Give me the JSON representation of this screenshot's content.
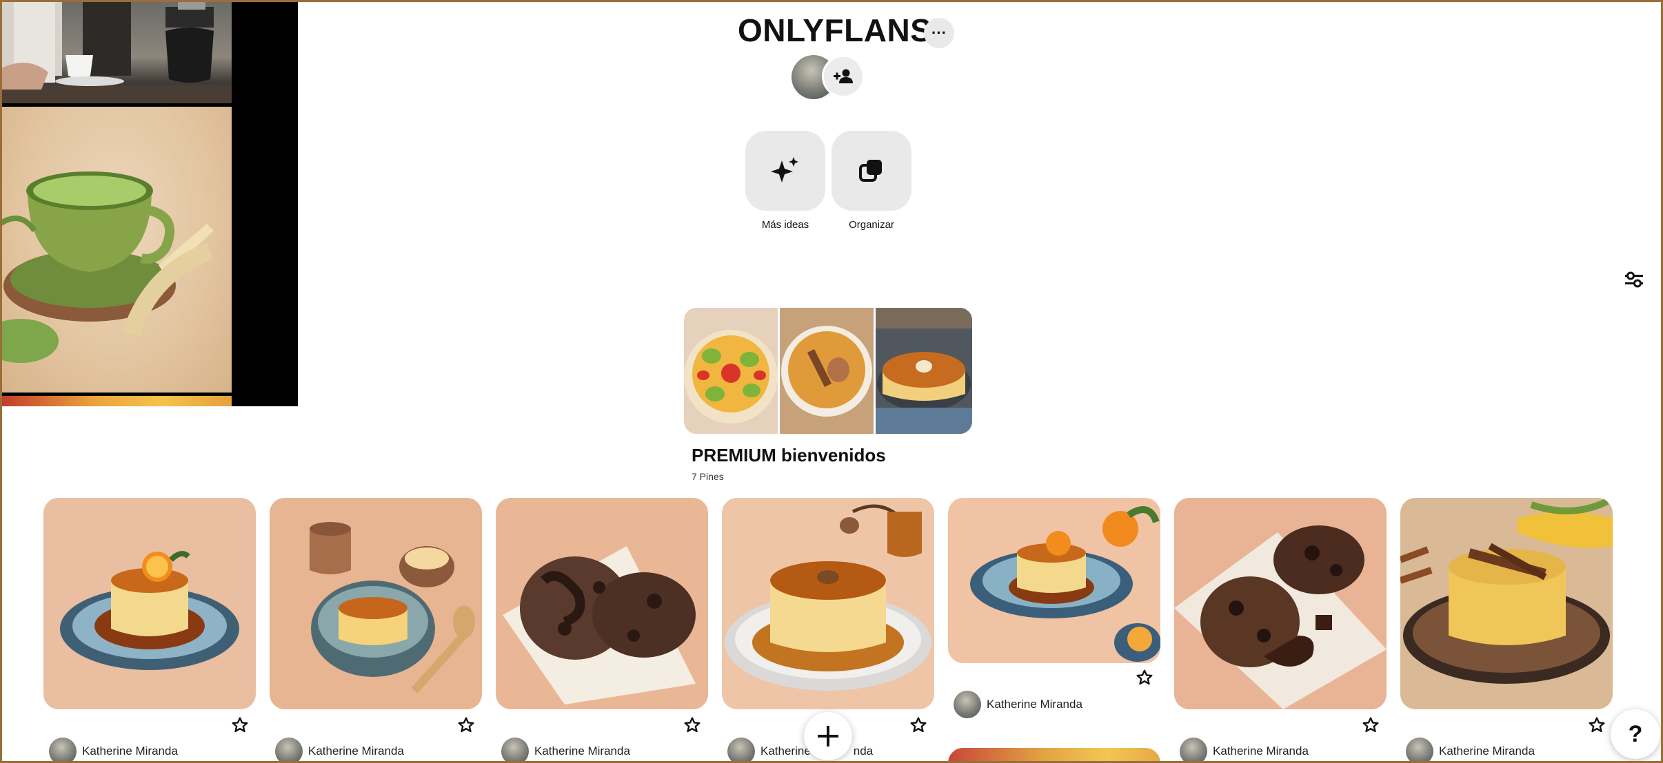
{
  "board": {
    "title": "ONLYFLANS",
    "more_label": "···"
  },
  "actions": [
    {
      "label": "Más ideas",
      "icon": "sparkle-icon"
    },
    {
      "label": "Organizar",
      "icon": "organize-icon"
    }
  ],
  "section": {
    "title": "PREMIUM bienvenidos",
    "pin_count": "7 Pines"
  },
  "pins": [
    {
      "user": "Katherine Miranda",
      "image": "flan-orange-blue-plate"
    },
    {
      "user": "Katherine Miranda",
      "image": "flan-bowl-honey"
    },
    {
      "user": "Katherine Miranda",
      "image": "chocolate-cookies"
    },
    {
      "user": "Katherine",
      "user_suffix": "nda",
      "image": "flan-caramel-plate"
    },
    {
      "user": "Katherine Miranda",
      "image": "flan-orange-slice"
    },
    {
      "user": "Katherine Miranda",
      "image": "chocolate-cookies-cloth"
    },
    {
      "user": "Katherine Miranda",
      "image": "corn-flan-cinnamon"
    }
  ],
  "help_label": "?",
  "colors": {
    "frame_border": "#9a6e3a",
    "button_bg": "#e9e9e9",
    "text": "#111111"
  }
}
